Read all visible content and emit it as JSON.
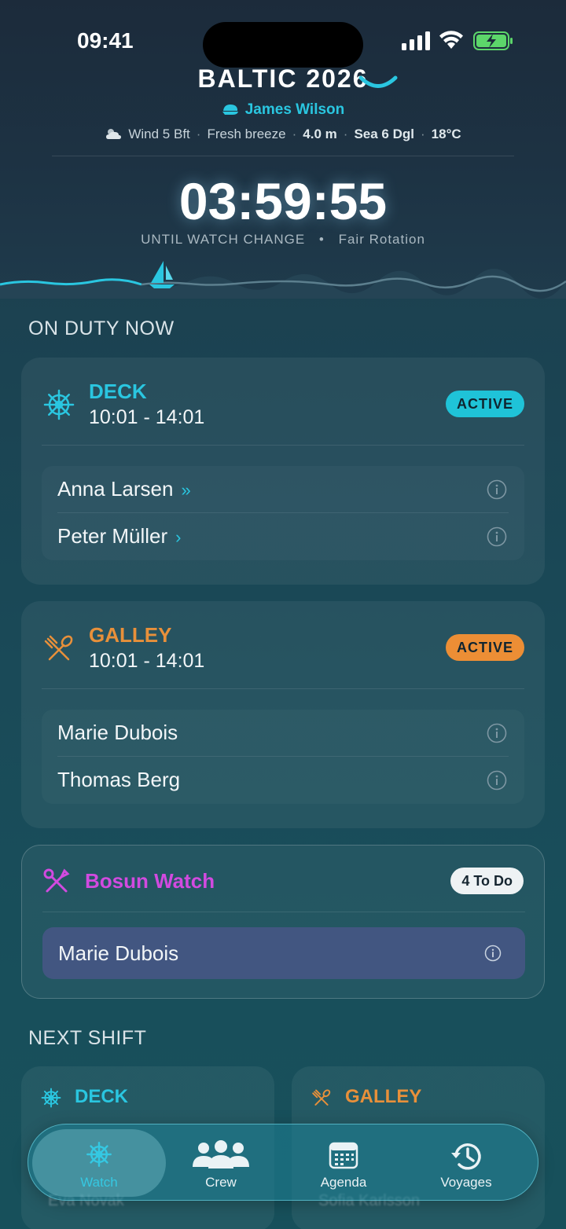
{
  "status_bar": {
    "time": "09:41"
  },
  "header": {
    "trip_name": "BALTIC 2026",
    "skipper": "James Wilson",
    "weather": {
      "wind": "Wind 5 Bft",
      "description": "Fresh breeze",
      "wave_height": "4.0 m",
      "sea_state": "Sea 6 Dgl",
      "temperature": "18°C"
    },
    "countdown": "03:59:55",
    "countdown_label": "UNTIL WATCH CHANGE",
    "rotation": "Fair Rotation",
    "separator": "•"
  },
  "on_duty": {
    "title": "ON DUTY NOW",
    "deck": {
      "title": "DECK",
      "time": "10:01 - 14:01",
      "badge": "ACTIVE",
      "members": [
        {
          "name": "Anna Larsen",
          "arrow": "»"
        },
        {
          "name": "Peter Müller",
          "arrow": "›"
        }
      ]
    },
    "galley": {
      "title": "GALLEY",
      "time": "10:01 - 14:01",
      "badge": "ACTIVE",
      "members": [
        {
          "name": "Marie Dubois"
        },
        {
          "name": "Thomas Berg"
        }
      ]
    },
    "bosun": {
      "title": "Bosun Watch",
      "todo": "4 To Do",
      "member": "Marie Dubois"
    }
  },
  "next_shift": {
    "title": "NEXT SHIFT",
    "deck": {
      "title": "DECK",
      "members": [
        "Eva Novak"
      ]
    },
    "galley": {
      "title": "GALLEY",
      "members": [
        "Sofia Karlsson"
      ]
    }
  },
  "tabbar": {
    "watch": "Watch",
    "crew": "Crew",
    "agenda": "Agenda",
    "voyages": "Voyages"
  },
  "colors": {
    "accent_teal": "#2ac6e0",
    "galley_orange": "#e8903a",
    "bosun_magenta": "#d24ae0",
    "badge_teal": "#1fc3d8",
    "badge_orange": "#ec8e35"
  },
  "icons": {
    "deck": "ship-wheel-icon",
    "galley": "fork-spoon-icon",
    "bosun": "tools-icon",
    "crew": "people-icon",
    "agenda": "calendar-icon",
    "voyages": "history-icon"
  }
}
